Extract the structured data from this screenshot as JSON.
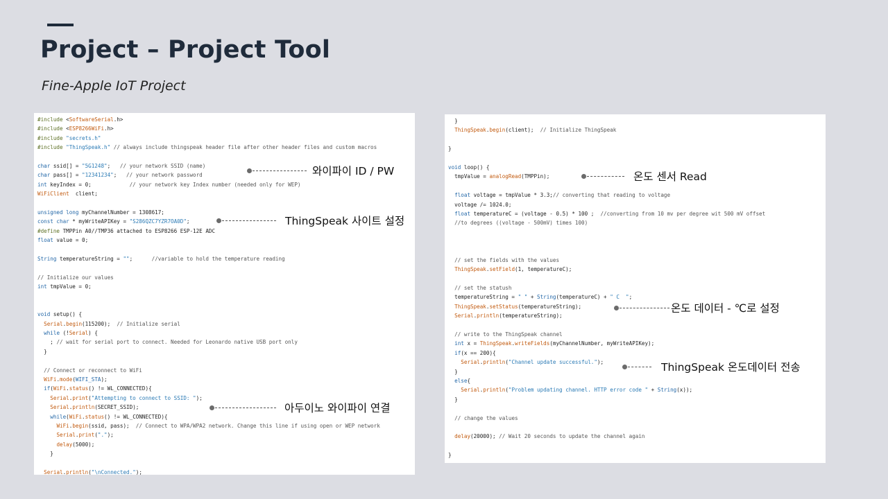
{
  "header": {
    "title": "Project – Project Tool",
    "subtitle": "Fine-Apple  IoT Project"
  },
  "colors": {
    "background": "#dcdde3",
    "title": "#1f2b3b",
    "panel": "#ffffff",
    "preprocessor": "#5c6f23",
    "keyword": "#2468a8",
    "function": "#c25a0e",
    "string": "#2a7ab5"
  },
  "left_code": [
    [
      [
        "pp",
        "#include "
      ],
      [
        "pun",
        "<"
      ],
      [
        "fn",
        "SoftwareSerial"
      ],
      [
        "pun",
        ".h>"
      ]
    ],
    [
      [
        "pp",
        "#include "
      ],
      [
        "pun",
        "<"
      ],
      [
        "fn",
        "ESP8266WiFi"
      ],
      [
        "pun",
        ".h>"
      ]
    ],
    [
      [
        "pp",
        "#include "
      ],
      [
        "str",
        "\"secrets.h\""
      ]
    ],
    [
      [
        "pp",
        "#include "
      ],
      [
        "str",
        "\"ThingSpeak.h\""
      ],
      [
        "com",
        " // always include thingspeak header file after other header files and custom macros"
      ]
    ],
    [],
    [
      [
        "kw",
        "char"
      ],
      [
        "id",
        " ssid[] = "
      ],
      [
        "str",
        "\"5G1248\""
      ],
      [
        "pun",
        ";"
      ],
      [
        "com",
        "   // your network SSID (name)"
      ]
    ],
    [
      [
        "kw",
        "char"
      ],
      [
        "id",
        " pass[] = "
      ],
      [
        "str",
        "\"12341234\""
      ],
      [
        "pun",
        ";"
      ],
      [
        "com",
        "   // your network password"
      ]
    ],
    [
      [
        "kw",
        "int"
      ],
      [
        "id",
        " keyIndex = 0;"
      ],
      [
        "com",
        "            // your network key Index number (needed only for WEP)"
      ]
    ],
    [
      [
        "fn",
        "WiFiClient"
      ],
      [
        "id",
        "  client;"
      ]
    ],
    [],
    [
      [
        "kw",
        "unsigned long"
      ],
      [
        "id",
        " myChannelNumber = 1308617;"
      ]
    ],
    [
      [
        "kw",
        "const char"
      ],
      [
        "id",
        " * myWriteAPIKey = "
      ],
      [
        "str",
        "\"S286QZC7YZR7OA0D\""
      ],
      [
        "pun",
        ";"
      ]
    ],
    [
      [
        "pp",
        "#define"
      ],
      [
        "id",
        " TMPPin A0//TMP36 attached to ESP8266 ESP-12E ADC"
      ]
    ],
    [
      [
        "kw",
        "float"
      ],
      [
        "id",
        " value = 0;"
      ]
    ],
    [],
    [
      [
        "kw",
        "String"
      ],
      [
        "id",
        " temperatureString = "
      ],
      [
        "str",
        "\"\""
      ],
      [
        "pun",
        ";"
      ],
      [
        "com",
        "      //variable to hold the temperature reading"
      ]
    ],
    [],
    [
      [
        "com",
        "// Initialize our values"
      ]
    ],
    [
      [
        "kw",
        "int"
      ],
      [
        "id",
        " tmpValue = 0;"
      ]
    ],
    [],
    [],
    [
      [
        "kw",
        "void"
      ],
      [
        "id",
        " setup() {"
      ]
    ],
    [
      [
        "id",
        "  "
      ],
      [
        "fn",
        "Serial"
      ],
      [
        "pun",
        "."
      ],
      [
        "fn",
        "begin"
      ],
      [
        "id",
        "(115200);  "
      ],
      [
        "com",
        "// Initialize serial"
      ]
    ],
    [
      [
        "id",
        "  "
      ],
      [
        "kw",
        "while"
      ],
      [
        "id",
        " (!"
      ],
      [
        "fn",
        "Serial"
      ],
      [
        "id",
        ") {"
      ]
    ],
    [
      [
        "id",
        "    ; "
      ],
      [
        "com",
        "// wait for serial port to connect. Needed for Leonardo native USB port only"
      ]
    ],
    [
      [
        "id",
        "  }"
      ]
    ],
    [],
    [
      [
        "id",
        "  "
      ],
      [
        "com",
        "// Connect or reconnect to WiFi"
      ]
    ],
    [
      [
        "id",
        "  "
      ],
      [
        "fn",
        "WiFi"
      ],
      [
        "pun",
        "."
      ],
      [
        "fn",
        "mode"
      ],
      [
        "id",
        "("
      ],
      [
        "kw",
        "WIFI_STA"
      ],
      [
        "id",
        ");"
      ]
    ],
    [
      [
        "id",
        "  "
      ],
      [
        "kw",
        "if"
      ],
      [
        "id",
        "("
      ],
      [
        "fn",
        "WiFi"
      ],
      [
        "pun",
        "."
      ],
      [
        "fn",
        "status"
      ],
      [
        "id",
        "() != WL_CONNECTED){"
      ]
    ],
    [
      [
        "id",
        "    "
      ],
      [
        "fn",
        "Serial"
      ],
      [
        "pun",
        "."
      ],
      [
        "fn",
        "print"
      ],
      [
        "id",
        "("
      ],
      [
        "str",
        "\"Attempting to connect to SSID: \""
      ],
      [
        "id",
        ");"
      ]
    ],
    [
      [
        "id",
        "    "
      ],
      [
        "fn",
        "Serial"
      ],
      [
        "pun",
        "."
      ],
      [
        "fn",
        "println"
      ],
      [
        "id",
        "(SECRET_SSID);"
      ]
    ],
    [
      [
        "id",
        "    "
      ],
      [
        "kw",
        "while"
      ],
      [
        "id",
        "("
      ],
      [
        "fn",
        "WiFi"
      ],
      [
        "pun",
        "."
      ],
      [
        "fn",
        "status"
      ],
      [
        "id",
        "() != WL_CONNECTED){"
      ]
    ],
    [
      [
        "id",
        "      "
      ],
      [
        "fn",
        "WiFi"
      ],
      [
        "pun",
        "."
      ],
      [
        "fn",
        "begin"
      ],
      [
        "id",
        "(ssid, pass);  "
      ],
      [
        "com",
        "// Connect to WPA/WPA2 network. Change this line if using open or WEP network"
      ]
    ],
    [
      [
        "id",
        "      "
      ],
      [
        "fn",
        "Serial"
      ],
      [
        "pun",
        "."
      ],
      [
        "fn",
        "print"
      ],
      [
        "id",
        "("
      ],
      [
        "str",
        "\".\""
      ],
      [
        "id",
        ");"
      ]
    ],
    [
      [
        "id",
        "      "
      ],
      [
        "fn",
        "delay"
      ],
      [
        "id",
        "(5000);"
      ]
    ],
    [
      [
        "id",
        "    }"
      ]
    ],
    [],
    [
      [
        "id",
        "  "
      ],
      [
        "fn",
        "Serial"
      ],
      [
        "pun",
        "."
      ],
      [
        "fn",
        "println"
      ],
      [
        "id",
        "("
      ],
      [
        "str",
        "\"\\nConnected.\""
      ],
      [
        "id",
        ");"
      ]
    ]
  ],
  "right_code": [
    [
      [
        "id",
        "  }"
      ]
    ],
    [
      [
        "id",
        "  "
      ],
      [
        "fn",
        "ThingSpeak"
      ],
      [
        "pun",
        "."
      ],
      [
        "fn",
        "begin"
      ],
      [
        "id",
        "(client);  "
      ],
      [
        "com",
        "// Initialize ThingSpeak"
      ]
    ],
    [],
    [
      [
        "id",
        "}"
      ]
    ],
    [],
    [
      [
        "kw",
        "void"
      ],
      [
        "id",
        " loop() {"
      ]
    ],
    [
      [
        "id",
        "  tmpValue = "
      ],
      [
        "fn",
        "analogRead"
      ],
      [
        "id",
        "(TMPPin);"
      ]
    ],
    [],
    [
      [
        "id",
        "  "
      ],
      [
        "kw",
        "float"
      ],
      [
        "id",
        " voltage = tmpValue * 3.3;"
      ],
      [
        "com",
        "// converting that reading to voltage"
      ]
    ],
    [
      [
        "id",
        "  voltage /= 1024.0;"
      ]
    ],
    [
      [
        "id",
        "  "
      ],
      [
        "kw",
        "float"
      ],
      [
        "id",
        " temperatureC = (voltage - 0.5) * 100 ;  "
      ],
      [
        "com",
        "//converting from 10 mv per degree wit 500 mV offset"
      ]
    ],
    [
      [
        "id",
        "  "
      ],
      [
        "com",
        "//to degrees ((voltage - 500mV) times 100)"
      ]
    ],
    [],
    [],
    [],
    [
      [
        "id",
        "  "
      ],
      [
        "com",
        "// set the fields with the values"
      ]
    ],
    [
      [
        "id",
        "  "
      ],
      [
        "fn",
        "ThingSpeak"
      ],
      [
        "pun",
        "."
      ],
      [
        "fn",
        "setField"
      ],
      [
        "id",
        "(1, temperatureC);"
      ]
    ],
    [],
    [
      [
        "id",
        "  "
      ],
      [
        "com",
        "// set the statush"
      ]
    ],
    [
      [
        "id",
        "  temperatureString = "
      ],
      [
        "str",
        "\" \""
      ],
      [
        "id",
        " + "
      ],
      [
        "kw",
        "String"
      ],
      [
        "id",
        "(temperatureC) + "
      ],
      [
        "str",
        "\" C  \""
      ],
      [
        "id",
        ";"
      ]
    ],
    [
      [
        "id",
        "  "
      ],
      [
        "fn",
        "ThingSpeak"
      ],
      [
        "pun",
        "."
      ],
      [
        "fn",
        "setStatus"
      ],
      [
        "id",
        "(temperatureString);"
      ]
    ],
    [
      [
        "id",
        "  "
      ],
      [
        "fn",
        "Serial"
      ],
      [
        "pun",
        "."
      ],
      [
        "fn",
        "println"
      ],
      [
        "id",
        "(temperatureString);"
      ]
    ],
    [],
    [
      [
        "id",
        "  "
      ],
      [
        "com",
        "// write to the ThingSpeak channel"
      ]
    ],
    [
      [
        "id",
        "  "
      ],
      [
        "kw",
        "int"
      ],
      [
        "id",
        " x = "
      ],
      [
        "fn",
        "ThingSpeak"
      ],
      [
        "pun",
        "."
      ],
      [
        "fn",
        "writeFields"
      ],
      [
        "id",
        "(myChannelNumber, myWriteAPIKey);"
      ]
    ],
    [
      [
        "id",
        "  "
      ],
      [
        "kw",
        "if"
      ],
      [
        "id",
        "(x == 200){"
      ]
    ],
    [
      [
        "id",
        "    "
      ],
      [
        "fn",
        "Serial"
      ],
      [
        "pun",
        "."
      ],
      [
        "fn",
        "println"
      ],
      [
        "id",
        "("
      ],
      [
        "str",
        "\"Channel update successful.\""
      ],
      [
        "id",
        ");"
      ]
    ],
    [
      [
        "id",
        "  }"
      ]
    ],
    [
      [
        "id",
        "  "
      ],
      [
        "kw",
        "else"
      ],
      [
        "id",
        "{"
      ]
    ],
    [
      [
        "id",
        "    "
      ],
      [
        "fn",
        "Serial"
      ],
      [
        "pun",
        "."
      ],
      [
        "fn",
        "println"
      ],
      [
        "id",
        "("
      ],
      [
        "str",
        "\"Problem updating channel. HTTP error code \""
      ],
      [
        "id",
        " + "
      ],
      [
        "kw",
        "String"
      ],
      [
        "id",
        "(x));"
      ]
    ],
    [
      [
        "id",
        "  }"
      ]
    ],
    [],
    [
      [
        "id",
        "  "
      ],
      [
        "com",
        "// change the values"
      ]
    ],
    [],
    [
      [
        "id",
        "  "
      ],
      [
        "fn",
        "delay"
      ],
      [
        "id",
        "(20000); "
      ],
      [
        "com",
        "// Wait 20 seconds to update the channel again"
      ]
    ],
    [],
    [
      [
        "id",
        "}"
      ]
    ]
  ],
  "annotations": [
    {
      "label": "와이파이 ID / PW"
    },
    {
      "label": "ThingSpeak 사이트 설정"
    },
    {
      "label": "아두이노 와이파이 연결"
    },
    {
      "label": "온도 센서 Read"
    },
    {
      "label": "온도 데이터 - ℃로 설정"
    },
    {
      "label": "ThingSpeak 온도데이터 전송"
    }
  ]
}
